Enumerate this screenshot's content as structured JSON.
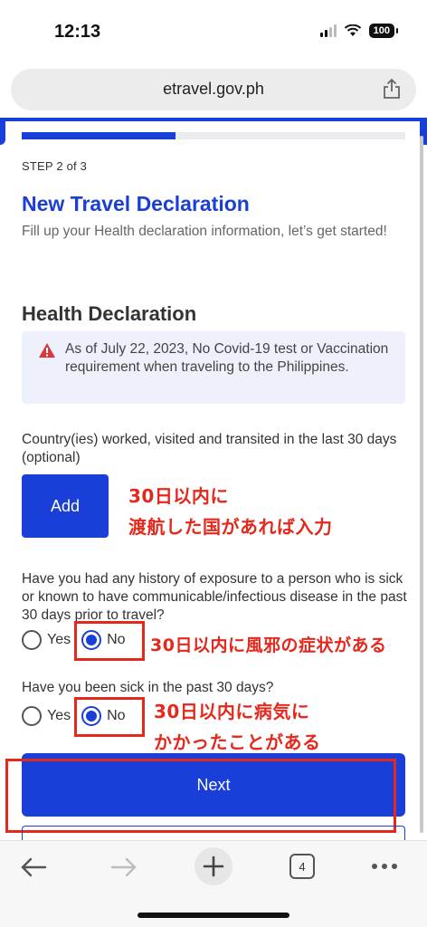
{
  "status_bar": {
    "time": "12:13",
    "battery": "100"
  },
  "browser": {
    "url": "etravel.gov.ph",
    "tab_count": "4"
  },
  "form": {
    "progress": 0.4,
    "step_label": "STEP 2 of 3",
    "title": "New Travel Declaration",
    "subtitle": "Fill up your Health declaration information, let’s get started!",
    "section_title": "Health Declaration",
    "notice": "As of July 22, 2023, No Covid-19 test or Vaccination requirement when traveling to the Philippines.",
    "countries_question": "Country(ies) worked, visited and transited in the last 30 days (optional)",
    "add_label": "Add",
    "exposure_question": "Have you had any history of exposure to a person who is sick or known to have communicable/infectious disease in the past 30 days prior to travel?",
    "sick_question": "Have you been sick in the past 30 days?",
    "yes_label": "Yes",
    "no_label": "No",
    "exposure_answer": "No",
    "sick_answer": "No",
    "next_label": "Next"
  },
  "annotations": {
    "countries_line1": "30日以内に",
    "countries_line2": "渡航した国があれば入力",
    "exposure": "30日以内に風邪の症状がある",
    "sick_line1": "30日以内に病気に",
    "sick_line2": "かかったことがある"
  },
  "colors": {
    "accent": "#1a3fd8",
    "annotation": "#e5281c",
    "notice_bg": "#eef1fb"
  }
}
